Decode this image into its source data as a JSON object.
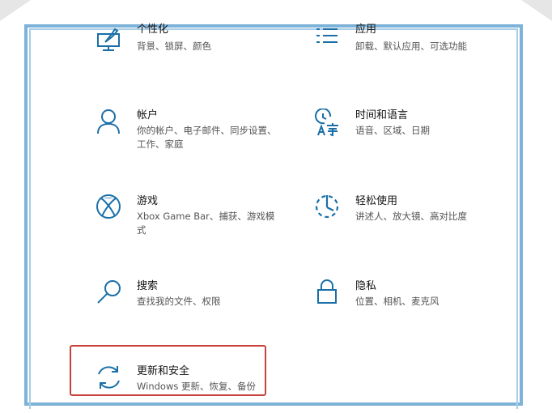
{
  "tiles": {
    "personalization": {
      "title": "个性化",
      "desc": "背景、锁屏、颜色",
      "icon": "personalization-icon"
    },
    "apps": {
      "title": "应用",
      "desc": "卸载、默认应用、可选功能",
      "icon": "apps-list-icon"
    },
    "accounts": {
      "title": "帐户",
      "desc": "你的帐户、电子邮件、同步设置、工作、家庭",
      "icon": "person-icon"
    },
    "time_language": {
      "title": "时间和语言",
      "desc": "语音、区域、日期",
      "icon": "time-language-icon"
    },
    "gaming": {
      "title": "游戏",
      "desc": "Xbox Game Bar、捕获、游戏模式",
      "icon": "xbox-icon"
    },
    "ease_of_access": {
      "title": "轻松使用",
      "desc": "讲述人、放大镜、高对比度",
      "icon": "ease-of-access-icon"
    },
    "search": {
      "title": "搜索",
      "desc": "查找我的文件、权限",
      "icon": "search-icon"
    },
    "privacy": {
      "title": "隐私",
      "desc": "位置、相机、麦克风",
      "icon": "lock-icon"
    },
    "update_security": {
      "title": "更新和安全",
      "desc": "Windows 更新、恢复、备份",
      "icon": "sync-icon"
    }
  },
  "colors": {
    "accent": "#1a6fa8",
    "highlight": "#c8413b",
    "frame": "#7eb3d9"
  }
}
